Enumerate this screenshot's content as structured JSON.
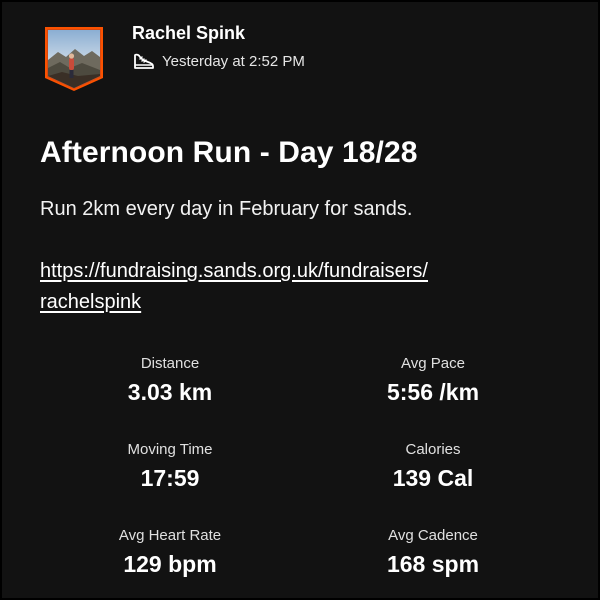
{
  "athlete": {
    "name": "Rachel Spink",
    "timestamp": "Yesterday at 2:52 PM"
  },
  "activity": {
    "title": "Afternoon Run - Day 18/28",
    "description": "Run 2km every day in February for sands.",
    "link_line1": "https://fundraising.sands.org.uk/fundraisers/",
    "link_line2": "rachelspink"
  },
  "stats": [
    {
      "label": "Distance",
      "value": "3.03 km"
    },
    {
      "label": "Avg Pace",
      "value": "5:56 /km"
    },
    {
      "label": "Moving Time",
      "value": "17:59"
    },
    {
      "label": "Calories",
      "value": "139 Cal"
    },
    {
      "label": "Avg Heart Rate",
      "value": "129 bpm"
    },
    {
      "label": "Avg Cadence",
      "value": "168 spm"
    }
  ],
  "icons": {
    "activity_type": "running-shoe-icon",
    "avatar": "avatar"
  },
  "colors": {
    "background": "#121212",
    "badge_accent": "#fc5200"
  }
}
